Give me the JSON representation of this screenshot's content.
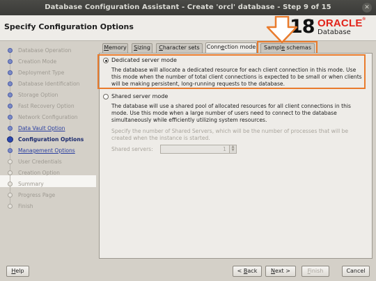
{
  "window": {
    "title": "Database Configuration Assistant - Create 'orcl' database - Step 9 of 15",
    "close_glyph": "✕"
  },
  "header": {
    "page_title": "Specify Configuration Options",
    "logo": {
      "version": "18",
      "version_sup": "c",
      "brand": "ORACLE",
      "brand_symbol": "®",
      "product": "Database"
    }
  },
  "nav": {
    "items": [
      {
        "label": "Database Operation",
        "state": "done"
      },
      {
        "label": "Creation Mode",
        "state": "done"
      },
      {
        "label": "Deployment Type",
        "state": "done"
      },
      {
        "label": "Database Identification",
        "state": "done"
      },
      {
        "label": "Storage Option",
        "state": "done"
      },
      {
        "label": "Fast Recovery Option",
        "state": "done"
      },
      {
        "label": "Network Configuration",
        "state": "done"
      },
      {
        "label": "Data Vault Option",
        "state": "link"
      },
      {
        "label": "Configuration Options",
        "state": "current"
      },
      {
        "label": "Management Options",
        "state": "link"
      },
      {
        "label": "User Credentials",
        "state": "pending"
      },
      {
        "label": "Creation Option",
        "state": "pending"
      },
      {
        "label": "Summary",
        "state": "pending"
      },
      {
        "label": "Progress Page",
        "state": "pending"
      },
      {
        "label": "Finish",
        "state": "pending"
      }
    ]
  },
  "tabs": [
    {
      "pre": "",
      "u": "M",
      "post": "emory"
    },
    {
      "pre": "",
      "u": "S",
      "post": "izing"
    },
    {
      "pre": "",
      "u": "C",
      "post": "haracter sets"
    },
    {
      "pre": "Conn",
      "u": "e",
      "post": "ction mode"
    },
    {
      "pre": "Sampl",
      "u": "e",
      "post": " schemas"
    }
  ],
  "active_tab_index": 3,
  "connection_mode": {
    "dedicated": {
      "label": "Dedicated server mode",
      "selected": true,
      "description": "The database will allocate a dedicated resource for each client connection in this mode. Use this mode when the number of total client connections is expected to be small or when clients will be making persistent, long-running requests to the database."
    },
    "shared": {
      "label": "Shared server mode",
      "selected": false,
      "description": "The database will use a shared pool of allocated resources for all client connections in this mode.  Use this mode when a large number of users need to connect to the database simultaneously while efficiently utilizing system resources.",
      "servers_hint": "Specify the number of Shared Servers, which will be the number of processes that will be created when the instance is started.",
      "servers_label": "Shared servers:",
      "servers_value": "1"
    }
  },
  "buttons": {
    "help": {
      "u": "H",
      "post": "elp"
    },
    "back": {
      "pre": "< ",
      "u": "B",
      "post": "ack"
    },
    "next": {
      "u": "N",
      "post": "ext >"
    },
    "finish": {
      "u": "F",
      "post": "inish"
    },
    "cancel": "Cancel"
  },
  "colors": {
    "annotation": "#e97b2c",
    "oracle_red": "#e2231a"
  }
}
